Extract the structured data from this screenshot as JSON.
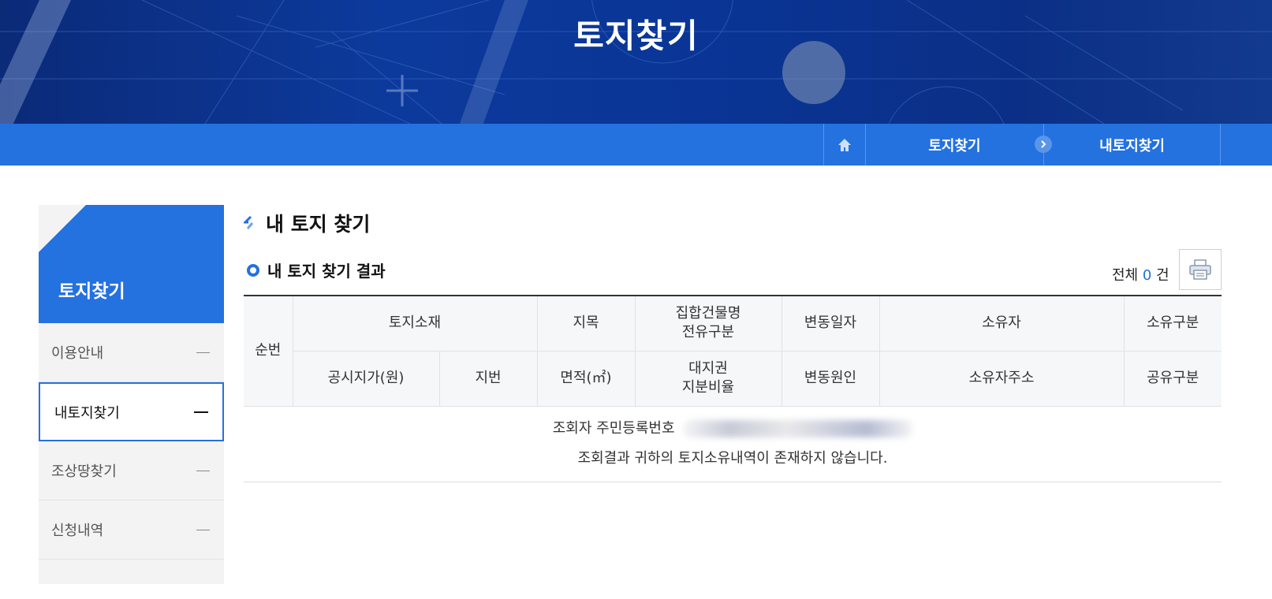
{
  "banner": {
    "title": "토지찾기"
  },
  "nav": {
    "home_icon": "home-icon",
    "crumbs": [
      "토지찾기",
      "내토지찾기"
    ],
    "separator_icon": "chevron-right-icon"
  },
  "sidebar": {
    "title": "토지찾기",
    "items": [
      {
        "label": "이용안내",
        "active": false
      },
      {
        "label": "내토지찾기",
        "active": true
      },
      {
        "label": "조상땅찾기",
        "active": false
      },
      {
        "label": "신청내역",
        "active": false
      }
    ]
  },
  "content": {
    "page_title": "내 토지 찾기",
    "section_title": "내 토지 찾기 결과",
    "total_prefix": "전체",
    "total_count": "0",
    "total_suffix": "건",
    "print_icon": "printer-icon"
  },
  "table": {
    "seq_header": "순번",
    "row1": [
      "토지소재",
      "지목",
      "집합건물명\n전유구분",
      "변동일자",
      "소유자",
      "소유구분"
    ],
    "row2": [
      "공시지가(원)",
      "지번",
      "면적(㎡)",
      "대지권\n지분비율",
      "변동원인",
      "소유자주소",
      "공유구분"
    ],
    "message_line1": "조회자 주민등록번호",
    "message_line2": "조회결과 귀하의 토지소유내역이 존재하지 않습니다."
  },
  "colors": {
    "primary": "#2471e0",
    "banner_dark": "#0b2a78"
  }
}
